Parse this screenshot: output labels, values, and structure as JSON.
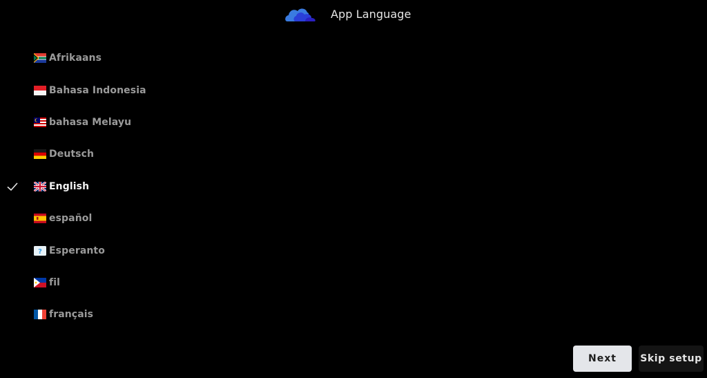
{
  "header": {
    "title": "App Language",
    "logo_icon": "cloud-logo-icon"
  },
  "languages": [
    {
      "label": "Afrikaans",
      "flag": "south-africa-flag-icon",
      "selected": false
    },
    {
      "label": "Bahasa Indonesia",
      "flag": "indonesia-flag-icon",
      "selected": false
    },
    {
      "label": "bahasa Melayu",
      "flag": "malaysia-flag-icon",
      "selected": false
    },
    {
      "label": "Deutsch",
      "flag": "germany-flag-icon",
      "selected": false
    },
    {
      "label": "English",
      "flag": "uk-flag-icon",
      "selected": true
    },
    {
      "label": "español",
      "flag": "spain-flag-icon",
      "selected": false
    },
    {
      "label": "Esperanto",
      "flag": "unknown-flag-icon",
      "selected": false
    },
    {
      "label": "fil",
      "flag": "philippines-flag-icon",
      "selected": false
    },
    {
      "label": "français",
      "flag": "france-flag-icon",
      "selected": false
    }
  ],
  "buttons": {
    "next_label": "Next",
    "skip_label": "Skip setup"
  },
  "colors": {
    "background": "#000000",
    "selected_text": "#f2f2f2",
    "unselected_text": "#9a9a9a",
    "next_bg": "#e4e6ea",
    "skip_bg": "#141414"
  }
}
